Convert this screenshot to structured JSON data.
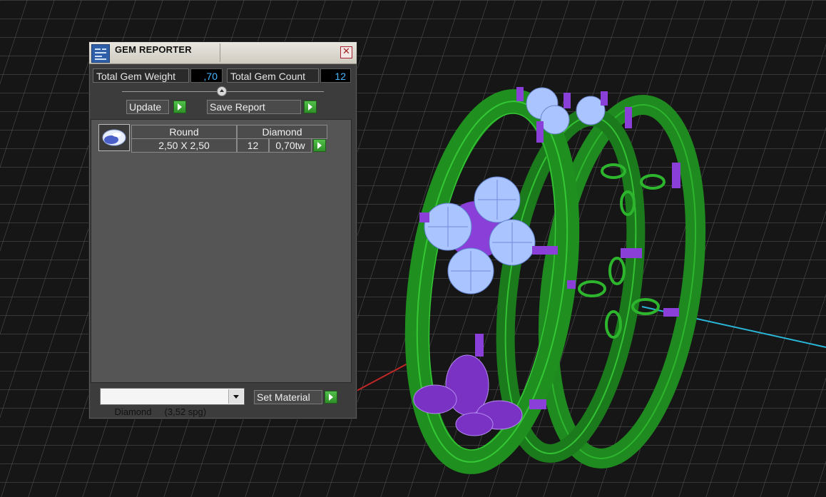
{
  "window": {
    "title": "GEM REPORTER",
    "close_glyph": "✕"
  },
  "summary": {
    "weight_label": "Total Gem Weight",
    "weight_value": ",70",
    "count_label": "Total Gem Count",
    "count_value": "12"
  },
  "buttons": {
    "update": "Update",
    "save_report": "Save Report",
    "set_material": "Set Material"
  },
  "gem_list": [
    {
      "shape": "Round",
      "material": "Diamond",
      "size": "2,50 X 2,50",
      "count": "12",
      "weight": "0,70tw"
    }
  ],
  "material_select": {
    "selected": "Diamond     (3,52 spg)"
  },
  "colors": {
    "ring_metal": "#1f8a1f",
    "gem_wireframe": "#a9c4ff",
    "prongs": "#8a3fd8",
    "value_text": "#47b7ff",
    "go_button": "#3fae37"
  },
  "icons": {
    "app": "gem-reporter-app-icon",
    "close": "close-icon",
    "go": "play-arrow-icon",
    "gem_thumb": "oval-gem-icon",
    "dropdown": "chevron-down-icon"
  }
}
